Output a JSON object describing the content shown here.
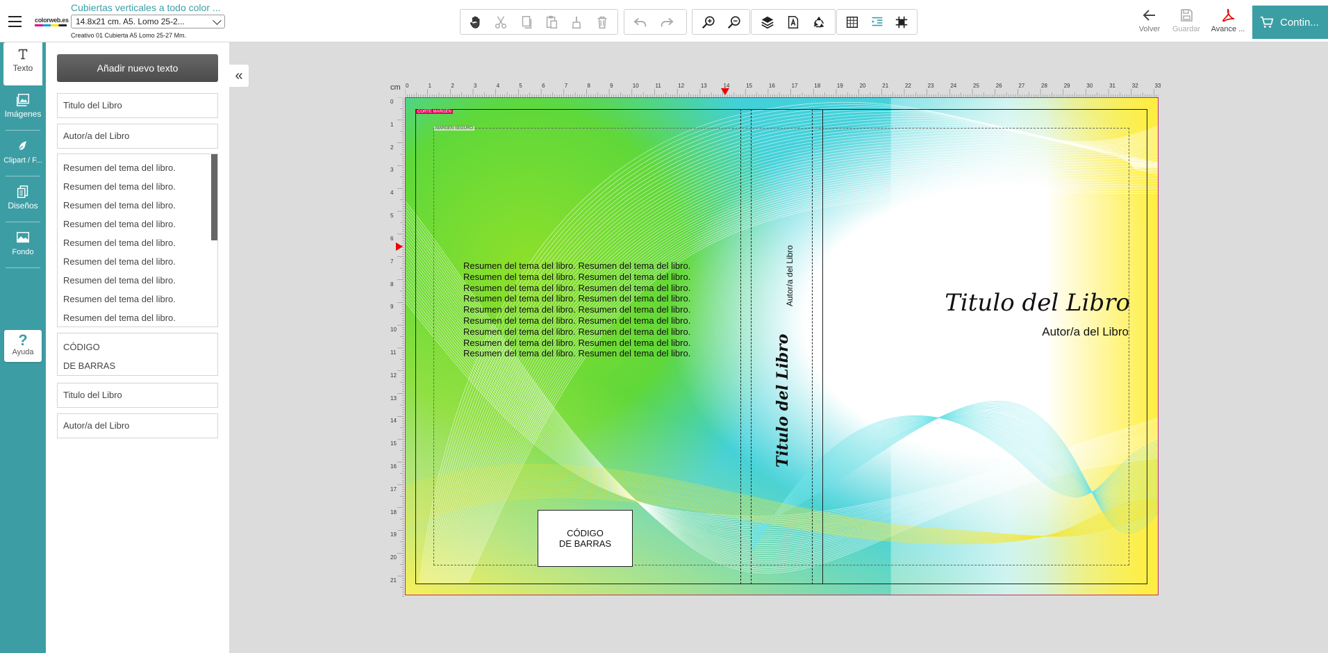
{
  "header": {
    "product_title": "Cubiertas verticales a todo color ...",
    "size_option": "14.8x21 cm. A5. Lomo 25-2...",
    "subtitle": "Creativo 01 Cubierta A5 Lomo 25-27 Mm.",
    "logo_text": "colorweb.es"
  },
  "toolbar": {
    "groups": [
      [
        "hand-icon",
        "cut-icon",
        "copy-icon",
        "paste-icon",
        "brush-icon",
        "trash-icon"
      ],
      [
        "undo-icon",
        "redo-icon"
      ],
      [
        "zoom-in-icon",
        "zoom-out-icon"
      ],
      [
        "layers-icon",
        "text-frame-icon",
        "recycle-icon"
      ],
      [
        "grid-icon",
        "align-icon",
        "snap-grid-icon"
      ]
    ]
  },
  "actions": {
    "back_label": "Volver",
    "save_label": "Guardar",
    "preview_label": "Avance ...",
    "continue_label": "Contin..."
  },
  "rail": {
    "items": [
      {
        "label": "Texto",
        "icon": "text-icon"
      },
      {
        "label": "Imágenes",
        "icon": "images-icon"
      },
      {
        "label": "Clipart / F...",
        "icon": "clipart-icon"
      },
      {
        "label": "Diseños",
        "icon": "designs-icon"
      },
      {
        "label": "Fondo",
        "icon": "background-icon"
      }
    ],
    "help_label": "Ayuda"
  },
  "panel": {
    "add_text_label": "Añadir nuevo texto",
    "fields": {
      "title_1": "Titulo del Libro",
      "author_1": "Autor/a del Libro",
      "summary_line": "Resumen del tema del libro.",
      "summary_line_count": 9,
      "barcode_line_1": "CÓDIGO",
      "barcode_line_2": "DE BARRAS",
      "title_2": "Titulo del Libro",
      "author_2": "Autor/a del Libro"
    }
  },
  "ruler": {
    "unit_label": "cm",
    "top_labels": [
      "0",
      "1",
      "2",
      "3",
      "4",
      "5",
      "6",
      "7",
      "8",
      "9",
      "10",
      "11",
      "12",
      "13",
      "14",
      "15",
      "16",
      "17",
      "18",
      "19",
      "20",
      "21",
      "22",
      "23",
      "24",
      "25",
      "26",
      "27",
      "28",
      "29",
      "30",
      "31",
      "32",
      "33"
    ],
    "left_labels": [
      "0",
      "1",
      "2",
      "3",
      "4",
      "5",
      "6",
      "7",
      "8",
      "9",
      "10",
      "11",
      "12",
      "13",
      "14",
      "15",
      "16",
      "17",
      "18",
      "19",
      "20",
      "21"
    ]
  },
  "canvas": {
    "tag_corte": "CORTE MARGEN",
    "tag_seguro": "MARGEN SEGURO",
    "back_summary_line": "Resumen del tema del libro. Resumen del tema del libro.",
    "barcode_line_1": "CÓDIGO",
    "barcode_line_2": "DE BARRAS",
    "spine_author": "Autor/a del Libro",
    "spine_title": "Titulo del Libro",
    "front_title": "Titulo del Libro",
    "front_author": "Autor/a del Libro"
  },
  "colors": {
    "accent": "#3c9ea4",
    "page_border": "#c42a6a",
    "marker": "#e00000"
  }
}
